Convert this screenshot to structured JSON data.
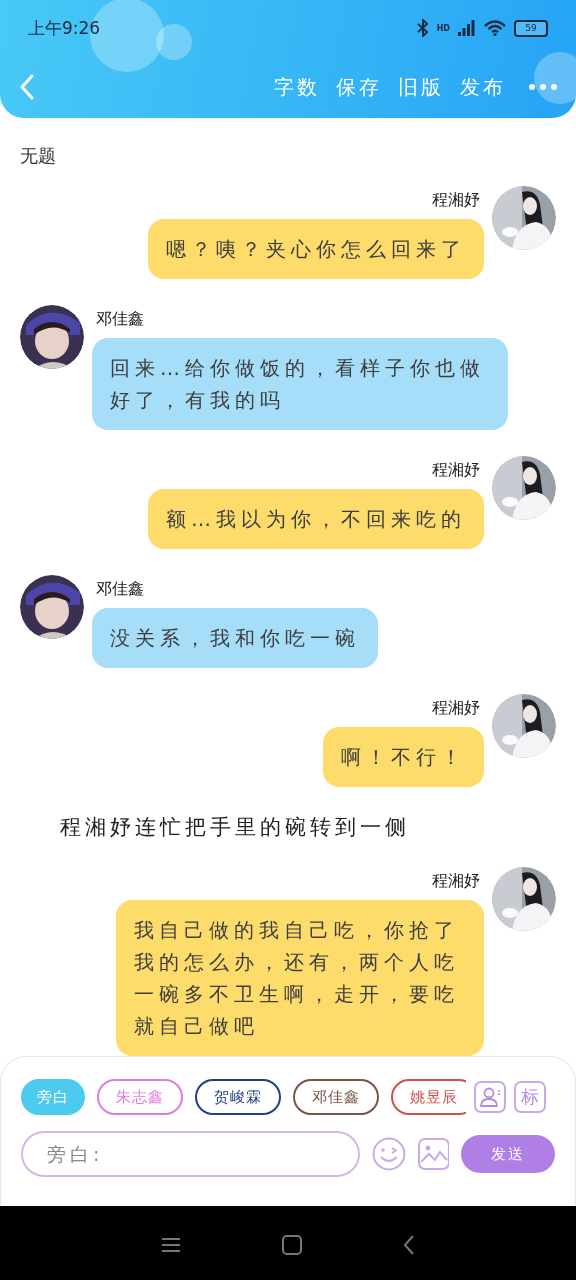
{
  "status_bar": {
    "time": "上午9:26",
    "signal_label": "HD",
    "battery": "59"
  },
  "toolbar": {
    "actions": [
      "字数",
      "保存",
      "旧版",
      "发布"
    ]
  },
  "title": "无题",
  "messages": [
    {
      "kind": "right",
      "name": "程湘妤",
      "text": "嗯？咦？夹心你怎么回来了"
    },
    {
      "kind": "left",
      "name": "邓佳鑫",
      "text": "回来…给你做饭的，看样子你也做好了，有我的吗"
    },
    {
      "kind": "right",
      "name": "程湘妤",
      "text": "额…我以为你，不回来吃的"
    },
    {
      "kind": "left",
      "name": "邓佳鑫",
      "text": "没关系，我和你吃一碗"
    },
    {
      "kind": "right",
      "name": "程湘妤",
      "text": "啊！不行！"
    },
    {
      "kind": "narration",
      "text": "程湘妤连忙把手里的碗转到一侧"
    },
    {
      "kind": "right",
      "name": "程湘妤",
      "text": "我自己做的我自己吃，你抢了我的怎么办，还有，两个人吃一碗多不卫生啊，走开，要吃就自己做吧"
    }
  ],
  "composer": {
    "roles": [
      {
        "label": "旁白",
        "selected": true,
        "color": "#4ccaf0"
      },
      {
        "label": "朱志鑫",
        "selected": false,
        "color": "#e07be0"
      },
      {
        "label": "贺峻霖",
        "selected": false,
        "color": "#1f3f87"
      },
      {
        "label": "邓佳鑫",
        "selected": false,
        "color": "#7a5548"
      },
      {
        "label": "姚昱辰",
        "selected": false,
        "color": "#d0504a"
      }
    ],
    "tag_button": "标",
    "placeholder": "旁白:",
    "send": "发送"
  }
}
